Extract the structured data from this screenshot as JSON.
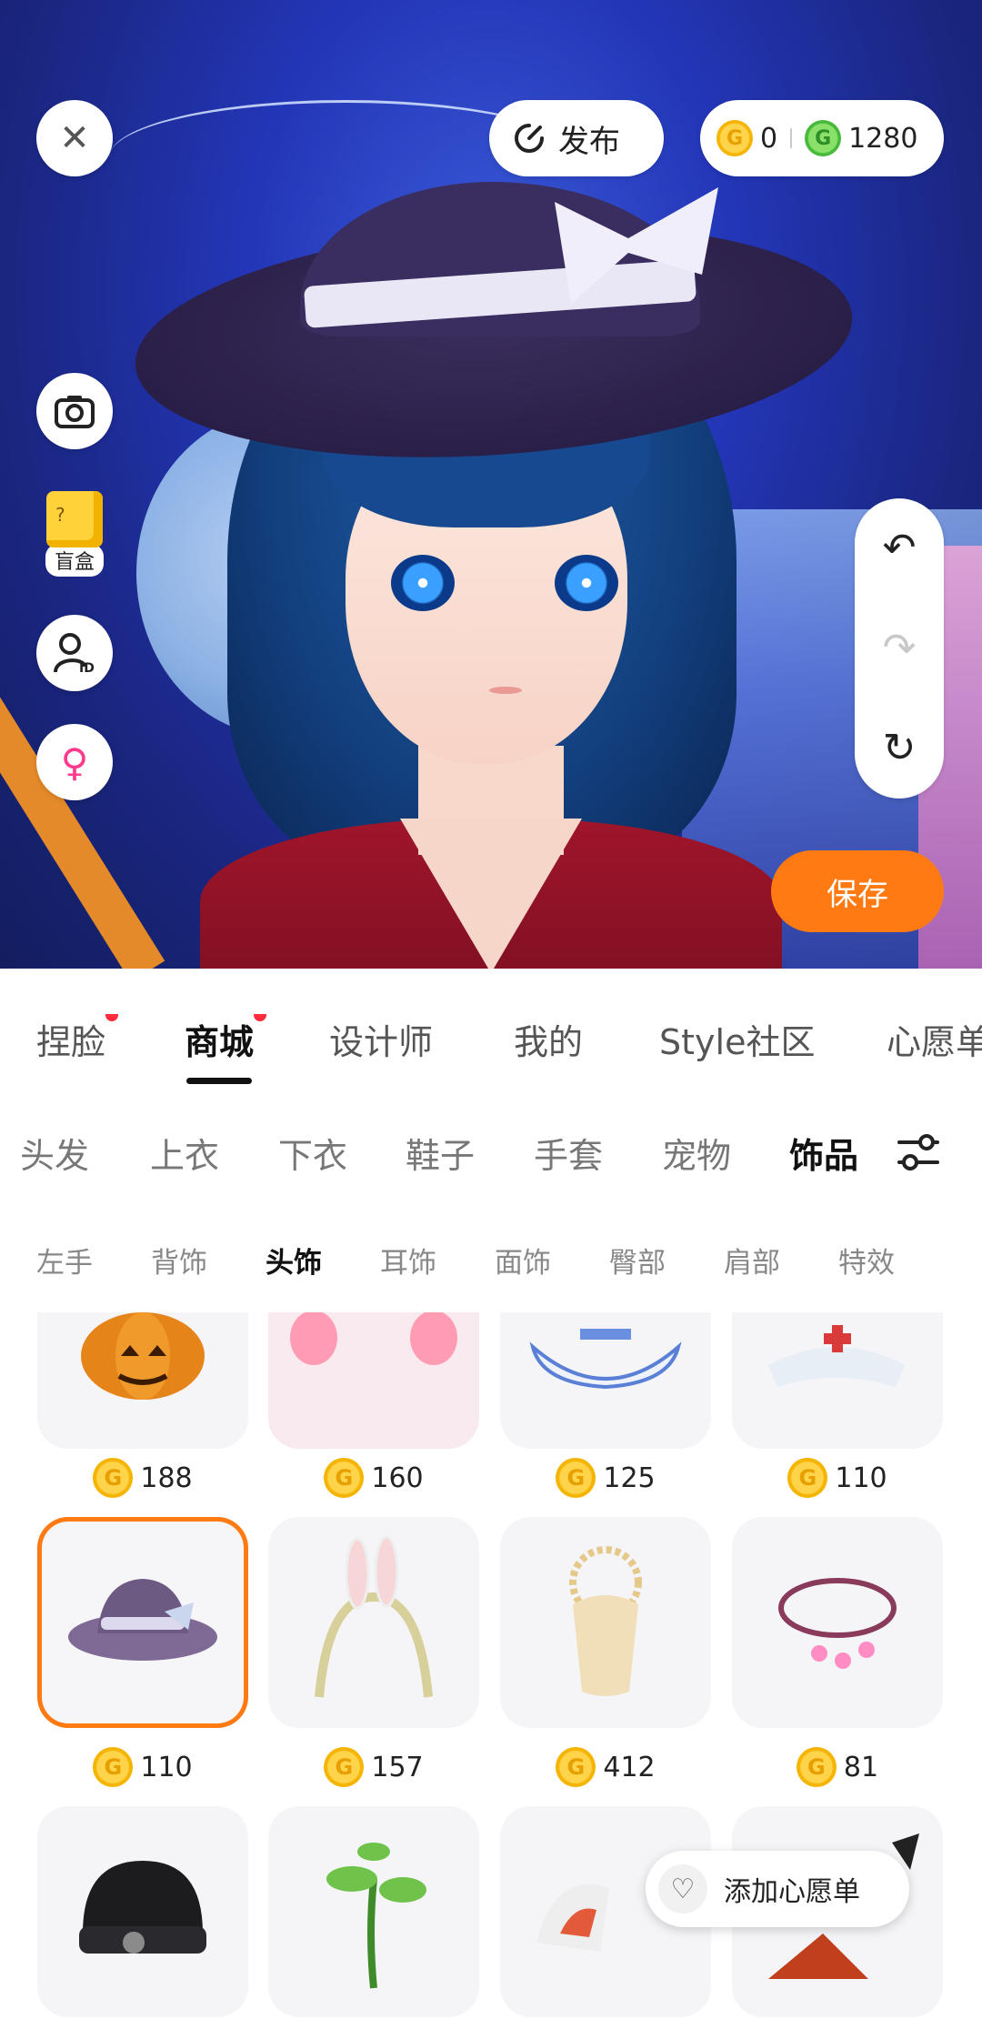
{
  "header": {
    "close_icon": "close-icon",
    "publish_label": "发布",
    "wallet": {
      "gold_amount": "0",
      "green_amount": "1280"
    }
  },
  "side": {
    "blindbox_label": "盲盒"
  },
  "actions": {
    "save_label": "保存"
  },
  "tabs": [
    {
      "label": "捏脸",
      "dot": true
    },
    {
      "label": "商城",
      "dot": true,
      "active": true
    },
    {
      "label": "设计师"
    },
    {
      "label": "我的"
    },
    {
      "label": "Style社区"
    },
    {
      "label": "心愿单"
    }
  ],
  "categories": [
    {
      "label": "头发"
    },
    {
      "label": "上衣"
    },
    {
      "label": "下衣"
    },
    {
      "label": "鞋子"
    },
    {
      "label": "手套"
    },
    {
      "label": "宠物"
    },
    {
      "label": "饰品",
      "active": true
    }
  ],
  "subcategories": [
    {
      "label": "左手"
    },
    {
      "label": "背饰"
    },
    {
      "label": "头饰",
      "active": true
    },
    {
      "label": "耳饰"
    },
    {
      "label": "面饰"
    },
    {
      "label": "臀部"
    },
    {
      "label": "肩部"
    },
    {
      "label": "特效"
    }
  ],
  "items": [
    {
      "name": "pumpkin-headwear",
      "price": "188"
    },
    {
      "name": "pink-ears-headwear",
      "price": "160"
    },
    {
      "name": "sun-hat-headwear",
      "price": "125"
    },
    {
      "name": "nurse-cap-headwear",
      "price": "110"
    },
    {
      "name": "witch-hat-headwear",
      "price": "110",
      "selected": true
    },
    {
      "name": "bunny-ears-headband",
      "price": "157"
    },
    {
      "name": "sun-crown-veil",
      "price": "412"
    },
    {
      "name": "charm-necklace",
      "price": "81"
    },
    {
      "name": "black-beanie",
      "price": ""
    },
    {
      "name": "sprout-headwear",
      "price": ""
    },
    {
      "name": "cat-hood-headwear",
      "price": ""
    },
    {
      "name": "cat-ears-headwear",
      "price": ""
    }
  ],
  "wishlist": {
    "label": "添加心愿单"
  },
  "colors": {
    "accent": "#ff7a12",
    "dot": "#ff2d3b",
    "gold": "#f4b400",
    "green": "#45b93a"
  }
}
